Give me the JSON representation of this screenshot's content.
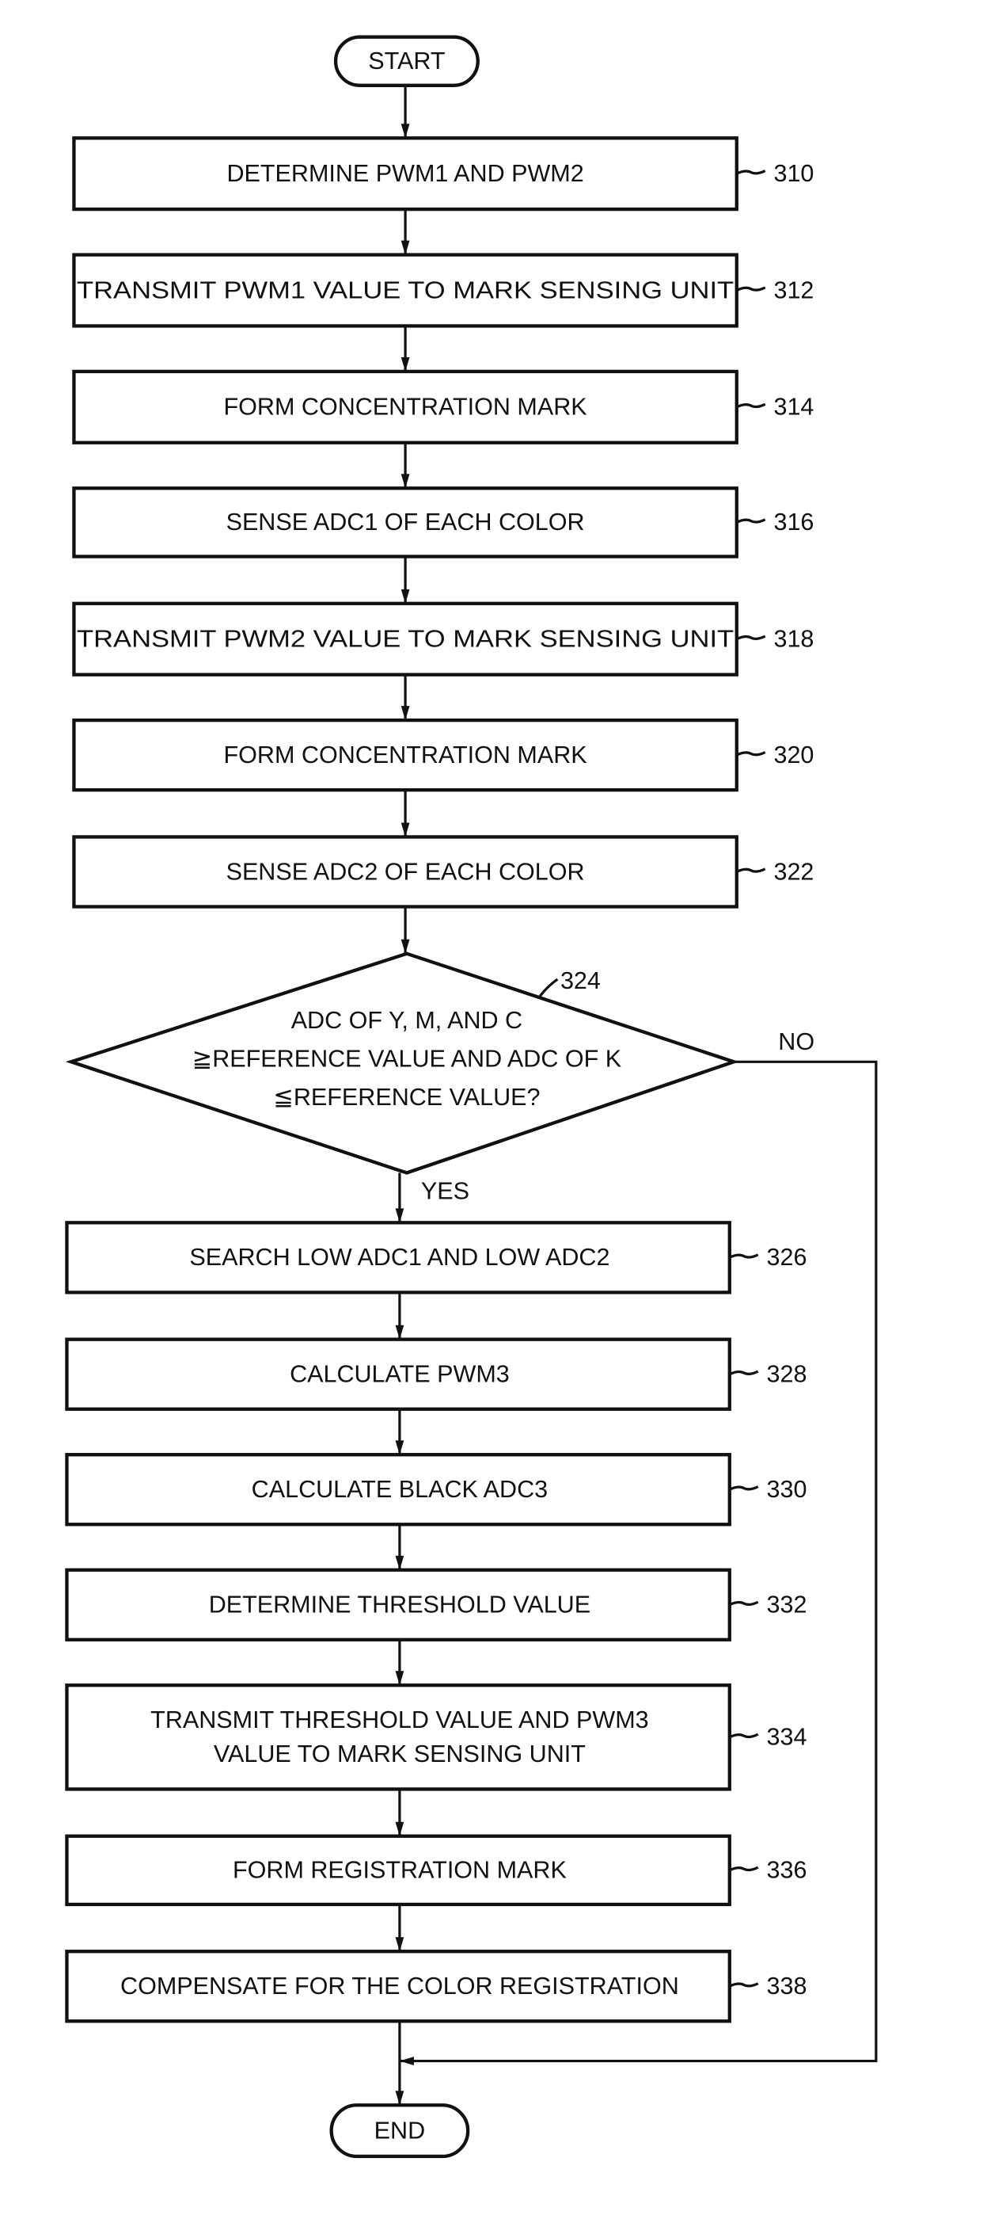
{
  "flowchart": {
    "start_label": "START",
    "end_label": "END",
    "steps_upper": [
      {
        "ref": "310",
        "text": [
          "DETERMINE PWM1 AND PWM2"
        ]
      },
      {
        "ref": "312",
        "text": [
          "TRANSMIT PWM1 VALUE TO MARK SENSING UNIT"
        ]
      },
      {
        "ref": "314",
        "text": [
          "FORM CONCENTRATION MARK"
        ]
      },
      {
        "ref": "316",
        "text": [
          "SENSE ADC1 OF EACH COLOR"
        ]
      },
      {
        "ref": "318",
        "text": [
          "TRANSMIT PWM2 VALUE TO MARK SENSING UNIT"
        ]
      },
      {
        "ref": "320",
        "text": [
          "FORM CONCENTRATION MARK"
        ]
      },
      {
        "ref": "322",
        "text": [
          "SENSE ADC2 OF EACH COLOR"
        ]
      }
    ],
    "decision": {
      "ref": "324",
      "text": [
        "ADC OF Y, M, AND C",
        "≧REFERENCE VALUE AND ADC OF K",
        "≦REFERENCE VALUE?"
      ],
      "yes_label": "YES",
      "no_label": "NO"
    },
    "steps_lower": [
      {
        "ref": "326",
        "text": [
          "SEARCH LOW ADC1 AND LOW ADC2"
        ]
      },
      {
        "ref": "328",
        "text": [
          "CALCULATE PWM3"
        ]
      },
      {
        "ref": "330",
        "text": [
          "CALCULATE BLACK ADC3"
        ]
      },
      {
        "ref": "332",
        "text": [
          "DETERMINE THRESHOLD VALUE"
        ]
      },
      {
        "ref": "334",
        "text": [
          "TRANSMIT THRESHOLD VALUE AND PWM3",
          "VALUE TO MARK SENSING UNIT"
        ]
      },
      {
        "ref": "336",
        "text": [
          "FORM REGISTRATION MARK"
        ]
      },
      {
        "ref": "338",
        "text": [
          "COMPENSATE FOR THE COLOR REGISTRATION"
        ]
      }
    ]
  }
}
